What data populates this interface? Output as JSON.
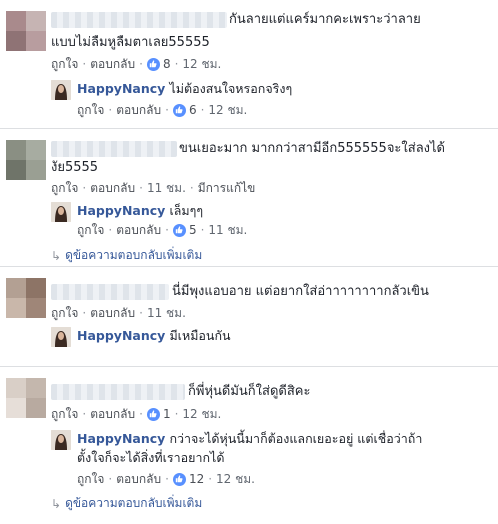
{
  "labels": {
    "like": "ถูกใจ",
    "reply": "ตอบกลับ",
    "edited": "มีการแก้ไข",
    "more_replies": "ดูข้อความตอบกลับเพิ่มเติม"
  },
  "reply_author": "HappyNancy",
  "colors": {
    "link": "#365899",
    "like_badge": "#5890ff",
    "meta": "#616770"
  },
  "threads": [
    {
      "comment": {
        "line1": "กันลายแต่แคร์มากคะเพราะว่าลาย",
        "line2": "แบบไม่ลืมหูลืมตาเลย55555",
        "likes": "8",
        "time": "12 ชม."
      },
      "reply": {
        "text": "ไม่ต้องสนใจหรอกจริงๆ",
        "likes": "6",
        "time": "12 ชม."
      }
    },
    {
      "comment": {
        "line1": "ขนเยอะมาก มากกว่าสามีอีก555555จะใส่ลงได้",
        "line2": "งัย5555",
        "time": "11 ชม."
      },
      "reply": {
        "text": "เล็มๆๆ",
        "likes": "5",
        "time": "11 ชม."
      }
    },
    {
      "comment": {
        "line1": "นี่มีพุงแอบอาย แต่อยากใส่อ่าาาาาาาากลัวเขิน",
        "time": "11 ชม."
      },
      "reply": {
        "text": "มีเหมือนกัน"
      }
    },
    {
      "comment": {
        "line1": "ก็พี่หุ่นดีมันก็ใส่ดูดีสิคะ",
        "likes": "1",
        "time": "12 ชม."
      },
      "reply": {
        "text": "กว่าจะได้หุ่นนี้มาก็ต้องแลกเยอะอยู่ แต่เชื่อว่าถ้า",
        "text2": "ตั้งใจก็จะได้สิ่งที่เราอยากได้",
        "likes": "12",
        "time": "12 ชม."
      }
    }
  ]
}
